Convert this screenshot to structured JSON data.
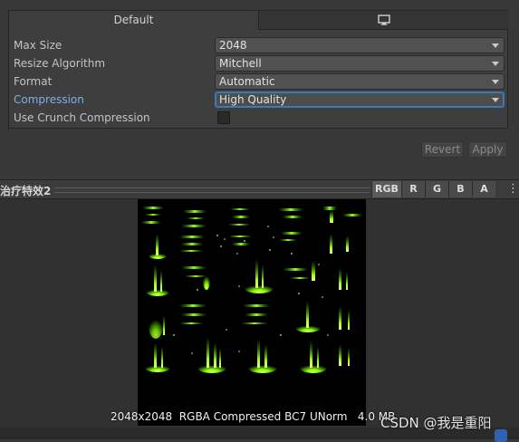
{
  "tabs": {
    "default_label": "Default",
    "standalone_icon": "monitor-icon"
  },
  "settings": [
    {
      "label": "Max Size",
      "value": "2048",
      "highlight": false,
      "focused": false
    },
    {
      "label": "Resize Algorithm",
      "value": "Mitchell",
      "highlight": false,
      "focused": false
    },
    {
      "label": "Format",
      "value": "Automatic",
      "highlight": false,
      "focused": false
    },
    {
      "label": "Compression",
      "value": "High Quality",
      "highlight": true,
      "focused": true
    }
  ],
  "crunch": {
    "label": "Use Crunch Compression",
    "checked": false
  },
  "actions": {
    "revert_label": "Revert",
    "apply_label": "Apply"
  },
  "preview": {
    "title": "治疗特效2",
    "channels": [
      "RGB",
      "R",
      "G",
      "B",
      "A"
    ],
    "info": "2048x2048  RGBA Compressed BC7 UNorm   4.0 MB",
    "watermark": "CSDN @我是重阳"
  },
  "colors": {
    "accent": "#3a79bb",
    "label_highlight": "#7cb0ec",
    "glow": "#7cff00"
  }
}
